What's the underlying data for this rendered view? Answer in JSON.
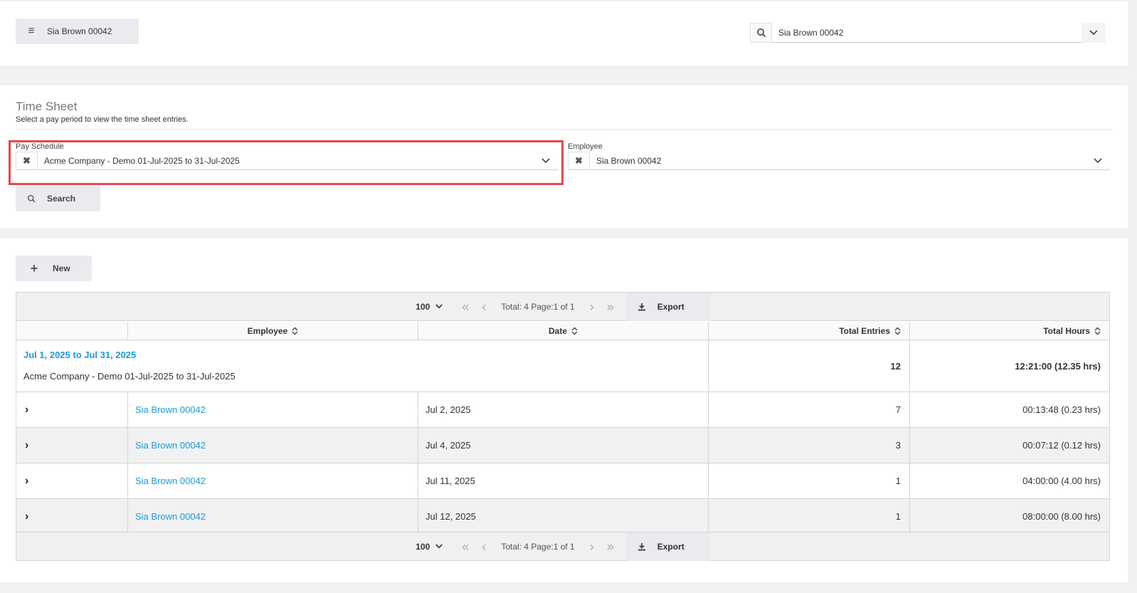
{
  "header": {
    "menu_label": "Sia Brown 00042",
    "search_value": "Sia Brown 00042"
  },
  "timesheet": {
    "title": "Time Sheet",
    "subtitle": "Select a pay period to view the time sheet entries.",
    "pay_schedule_label": "Pay Schedule",
    "pay_schedule_value": "Acme Company - Demo 01-Jul-2025 to 31-Jul-2025",
    "employee_label": "Employee",
    "employee_value": "Sia Brown 00042",
    "search_label": "Search"
  },
  "grid": {
    "new_label": "New",
    "page_size": "100",
    "pager_info": "Total: 4 Page:1 of 1",
    "export_label": "Export",
    "columns": [
      "Employee",
      "Date",
      "Total Entries",
      "Total Hours"
    ],
    "group": {
      "title": "Jul 1, 2025 to Jul 31, 2025",
      "subtitle": "Acme Company - Demo 01-Jul-2025 to 31-Jul-2025",
      "total_entries": "12",
      "total_hours": "12:21:00 (12.35 hrs)"
    },
    "rows": [
      {
        "employee": "Sia Brown 00042",
        "date": "Jul 2, 2025",
        "entries": "7",
        "hours": "00:13:48 (0.23 hrs)"
      },
      {
        "employee": "Sia Brown 00042",
        "date": "Jul 4, 2025",
        "entries": "3",
        "hours": "00:07:12 (0.12 hrs)"
      },
      {
        "employee": "Sia Brown 00042",
        "date": "Jul 11, 2025",
        "entries": "1",
        "hours": "04:00:00 (4.00 hrs)"
      },
      {
        "employee": "Sia Brown 00042",
        "date": "Jul 12, 2025",
        "entries": "1",
        "hours": "08:00:00 (8.00 hrs)"
      }
    ]
  },
  "colors": {
    "link": "#1e9ad6",
    "highlight": "#e5484d",
    "button_bg": "#e9ebee"
  }
}
